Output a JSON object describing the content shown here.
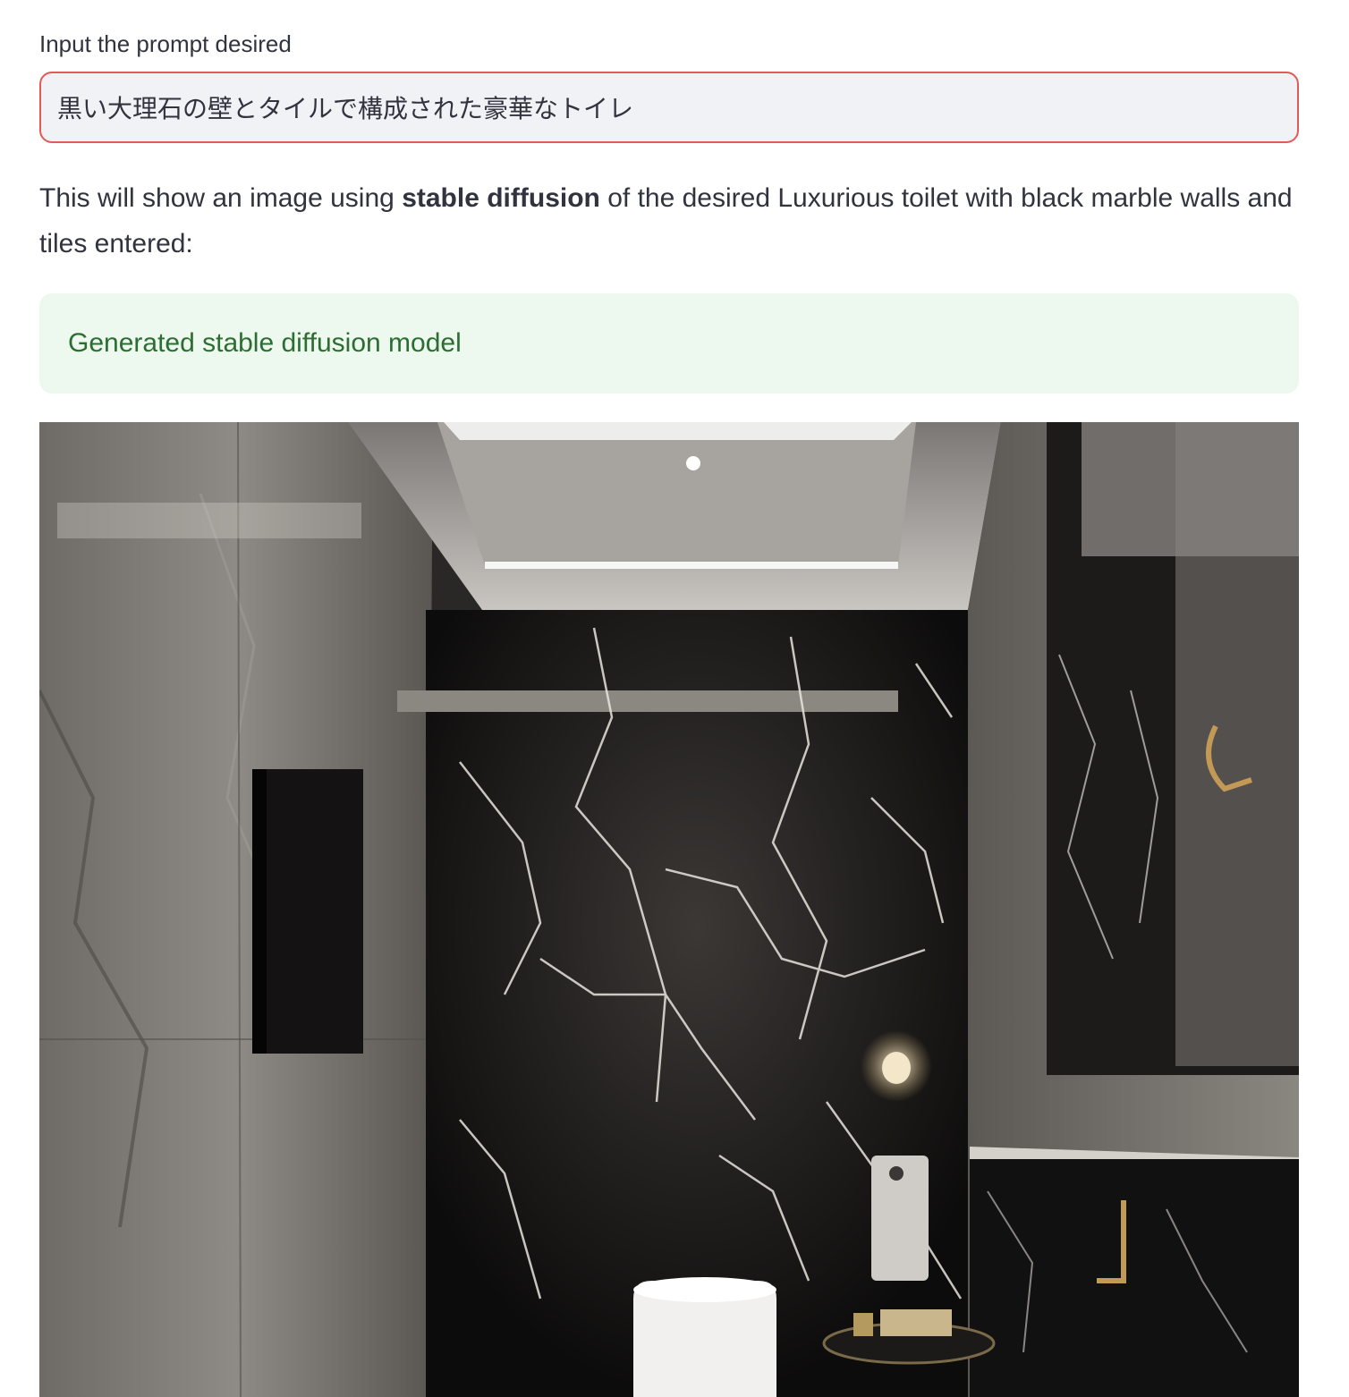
{
  "prompt_input": {
    "label": "Input the prompt desired",
    "value": "黒い大理石の壁とタイルで構成された豪華なトイレ"
  },
  "description": {
    "prefix": "This will show an image using ",
    "bold": "stable diffusion",
    "suffix": " of the desired Luxurious toilet with black marble walls and tiles entered:"
  },
  "status": {
    "message": "Generated stable diffusion model",
    "color": "#2c6e32",
    "background": "#edf8ee"
  },
  "generated_image": {
    "subject": "generated-bathroom-image"
  },
  "colors": {
    "input_border": "#e05a57",
    "input_bg": "#f0f2f6",
    "text": "#31333f"
  }
}
